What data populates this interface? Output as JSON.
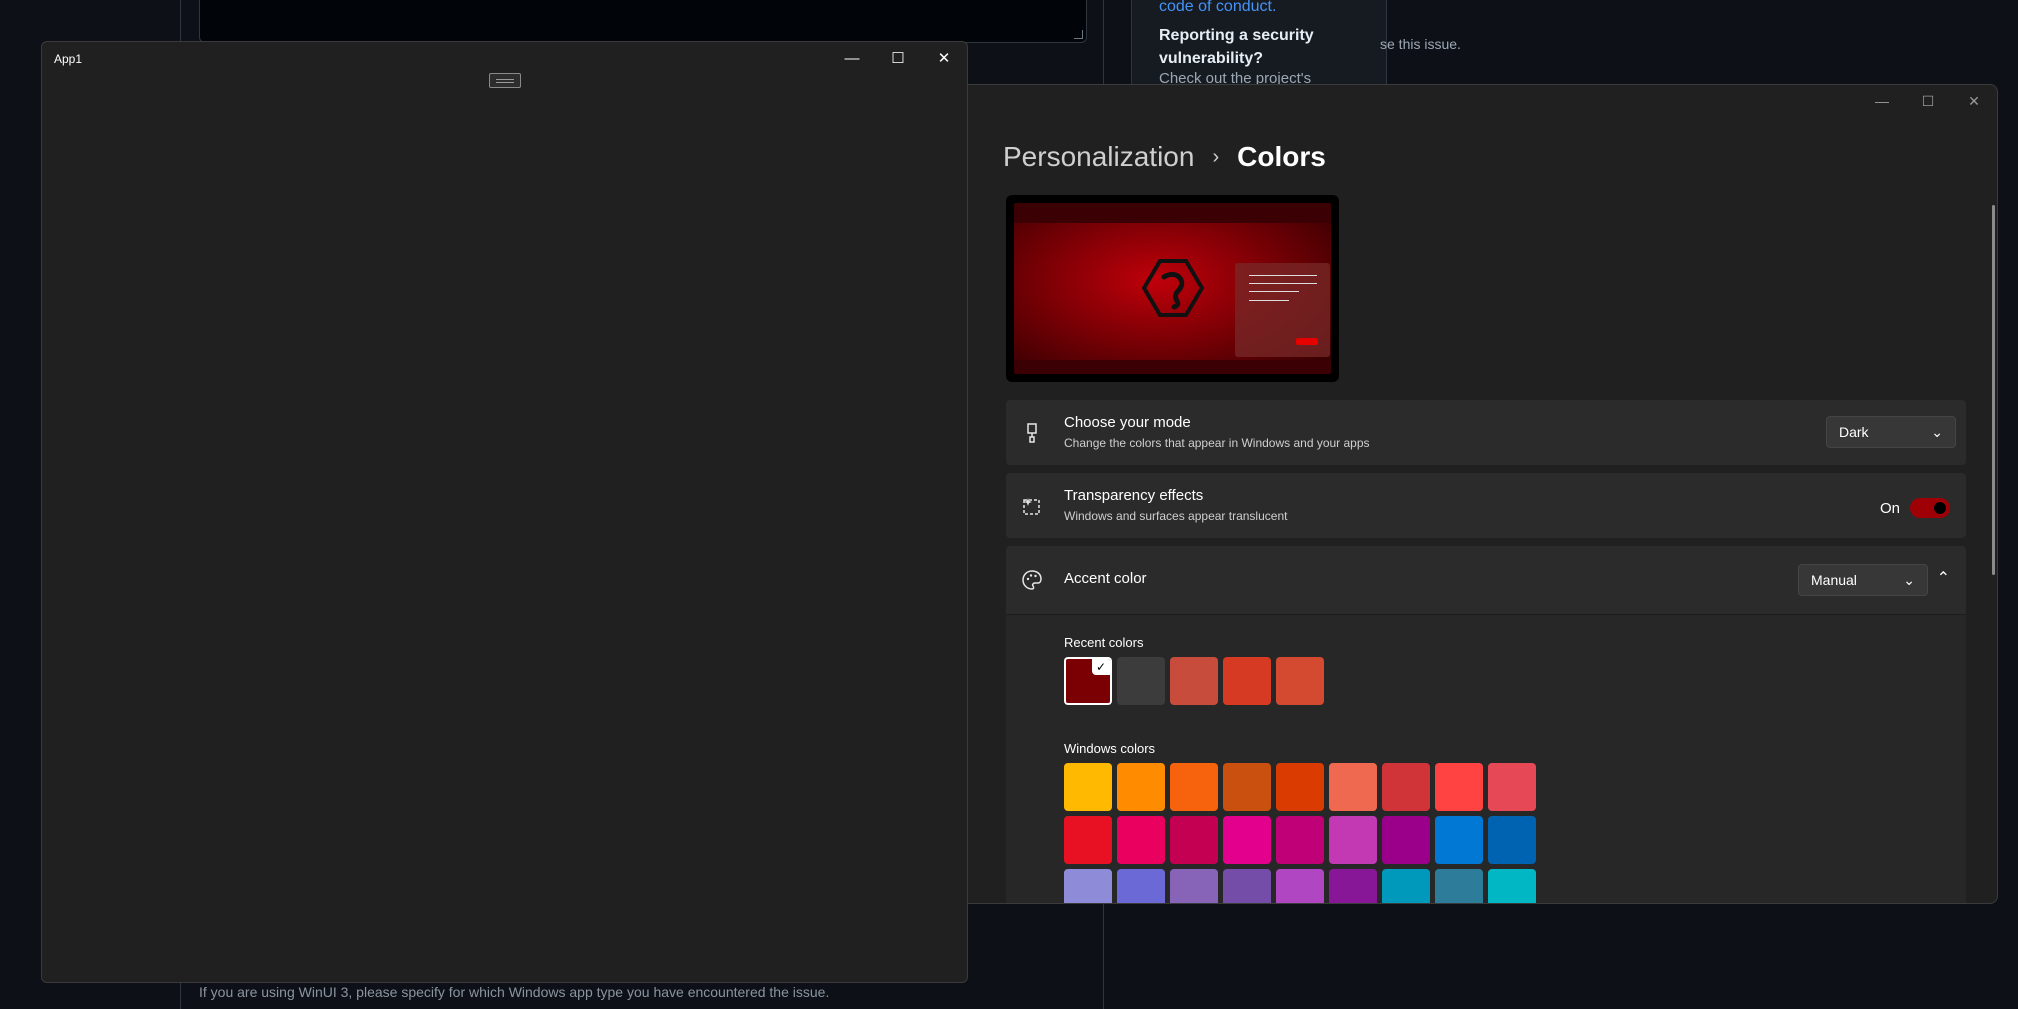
{
  "background": {
    "card_link": "code of conduct.",
    "card_question": "Reporting a security vulnerability?",
    "card_sub": "Check out the project's",
    "fragment": "se this issue.",
    "bottom_text": "If you are using WinUI 3, please specify for which Windows app type you have encountered the issue."
  },
  "app1": {
    "title": "App1",
    "caption": {
      "minimize": "—",
      "maximize": "☐",
      "close": "✕"
    }
  },
  "settings": {
    "caption": {
      "minimize": "—",
      "maximize": "☐",
      "close": "✕"
    },
    "breadcrumb": {
      "parent": "Personalization",
      "separator": "›",
      "current": "Colors"
    },
    "mode": {
      "title": "Choose your mode",
      "desc": "Change the colors that appear in Windows and your apps",
      "value": "Dark",
      "icon": "paintbrush-icon"
    },
    "transparency": {
      "title": "Transparency effects",
      "desc": "Windows and surfaces appear translucent",
      "state": "On",
      "icon": "transparency-sparkle-icon"
    },
    "accent": {
      "title": "Accent color",
      "value": "Manual",
      "icon": "palette-icon"
    },
    "recent_label": "Recent colors",
    "windows_label": "Windows colors",
    "recent_colors": [
      "#7a0004",
      "#3c3c3c",
      "#c84c3c",
      "#d73a22",
      "#d44a30"
    ],
    "windows_colors": [
      [
        "#ffb900",
        "#ff8c00",
        "#f7630c",
        "#ca5010",
        "#da3b01",
        "#ef6950",
        "#d13438",
        "#ff4343",
        "#e74856"
      ],
      [
        "#e81123",
        "#ea005e",
        "#c30052",
        "#e3008c",
        "#bf0077",
        "#c239b3",
        "#9a0089",
        "#0078d4",
        "#0063b1"
      ],
      [
        "#8e8cd8",
        "#6b69d6",
        "#8764b8",
        "#744da9",
        "#b146c2",
        "#881798",
        "#0099bc",
        "#2d7d9a",
        "#00b7c3"
      ]
    ],
    "accent_brand_color": "#9e0006"
  }
}
